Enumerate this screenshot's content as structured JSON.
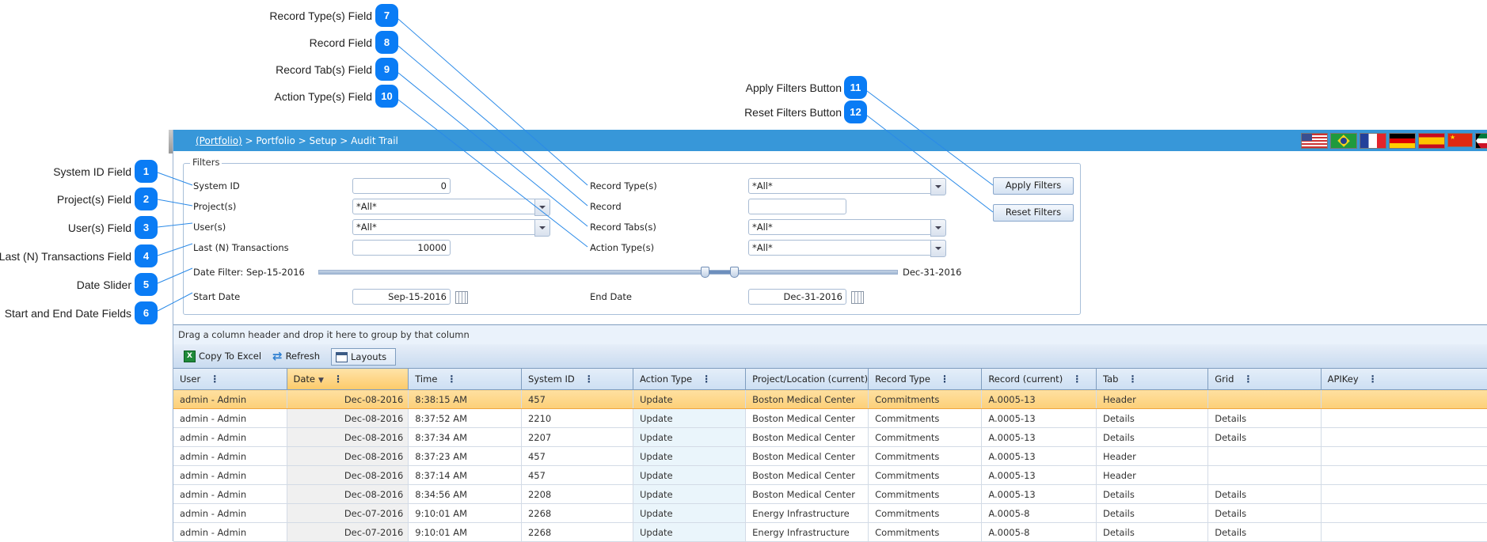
{
  "callouts": [
    {
      "n": "1",
      "label": "System ID Field"
    },
    {
      "n": "2",
      "label": "Project(s) Field"
    },
    {
      "n": "3",
      "label": "User(s) Field"
    },
    {
      "n": "4",
      "label": "Last (N) Transactions Field"
    },
    {
      "n": "5",
      "label": "Date Slider"
    },
    {
      "n": "6",
      "label": "Start and End Date Fields"
    },
    {
      "n": "7",
      "label": "Record Type(s) Field"
    },
    {
      "n": "8",
      "label": "Record Field"
    },
    {
      "n": "9",
      "label": "Record Tab(s) Field"
    },
    {
      "n": "10",
      "label": "Action Type(s) Field"
    },
    {
      "n": "11",
      "label": "Apply Filters Button"
    },
    {
      "n": "12",
      "label": "Reset Filters Button"
    }
  ],
  "breadcrumb": {
    "root": "(Portfolio)",
    "rest": " > Portfolio > Setup > Audit Trail"
  },
  "flags": [
    {
      "name": "us-flag"
    },
    {
      "name": "brazil-flag"
    },
    {
      "name": "france-flag"
    },
    {
      "name": "germany-flag"
    },
    {
      "name": "spain-flag"
    },
    {
      "name": "china-flag"
    },
    {
      "name": "kuwait-flag"
    }
  ],
  "filters": {
    "legend": "Filters",
    "system_id": {
      "label": "System ID",
      "value": "0"
    },
    "projects": {
      "label": "Project(s)",
      "value": "*All*"
    },
    "users": {
      "label": "User(s)",
      "value": "*All*"
    },
    "last_n": {
      "label": "Last (N) Transactions",
      "value": "10000"
    },
    "date_filter": {
      "label": "Date Filter: Sep-15-2016",
      "end_label": "Dec-31-2016"
    },
    "start_date": {
      "label": "Start Date",
      "value": "Sep-15-2016"
    },
    "end_date": {
      "label": "End Date",
      "value": "Dec-31-2016"
    },
    "record_types": {
      "label": "Record Type(s)",
      "value": "*All*"
    },
    "record": {
      "label": "Record",
      "value": ""
    },
    "record_tabs": {
      "label": "Record Tabs(s)",
      "value": "*All*"
    },
    "action_types": {
      "label": "Action Type(s)",
      "value": "*All*"
    },
    "apply_label": "Apply Filters",
    "reset_label": "Reset Filters"
  },
  "grid": {
    "group_hint": "Drag a column header and drop it here to group by that column",
    "toolbar": {
      "copy_excel": "Copy To Excel",
      "refresh": "Refresh",
      "layouts": "Layouts"
    },
    "columns": [
      "User",
      "Date",
      "Time",
      "System ID",
      "Action Type",
      "Project/Location (current)",
      "Record Type",
      "Record (current)",
      "Tab",
      "Grid",
      "APIKey"
    ],
    "rows": [
      [
        "admin - Admin",
        "Dec-08-2016",
        "8:38:15 AM",
        "457",
        "Update",
        "Boston Medical Center",
        "Commitments",
        "A.0005-13",
        "Header",
        "",
        ""
      ],
      [
        "admin - Admin",
        "Dec-08-2016",
        "8:37:52 AM",
        "2210",
        "Update",
        "Boston Medical Center",
        "Commitments",
        "A.0005-13",
        "Details",
        "Details",
        ""
      ],
      [
        "admin - Admin",
        "Dec-08-2016",
        "8:37:34 AM",
        "2207",
        "Update",
        "Boston Medical Center",
        "Commitments",
        "A.0005-13",
        "Details",
        "Details",
        ""
      ],
      [
        "admin - Admin",
        "Dec-08-2016",
        "8:37:23 AM",
        "457",
        "Update",
        "Boston Medical Center",
        "Commitments",
        "A.0005-13",
        "Header",
        "",
        ""
      ],
      [
        "admin - Admin",
        "Dec-08-2016",
        "8:37:14 AM",
        "457",
        "Update",
        "Boston Medical Center",
        "Commitments",
        "A.0005-13",
        "Header",
        "",
        ""
      ],
      [
        "admin - Admin",
        "Dec-08-2016",
        "8:34:56 AM",
        "2208",
        "Update",
        "Boston Medical Center",
        "Commitments",
        "A.0005-13",
        "Details",
        "Details",
        ""
      ],
      [
        "admin - Admin",
        "Dec-07-2016",
        "9:10:01 AM",
        "2268",
        "Update",
        "Energy Infrastructure",
        "Commitments",
        "A.0005-8",
        "Details",
        "Details",
        ""
      ],
      [
        "admin - Admin",
        "Dec-07-2016",
        "9:10:01 AM",
        "2268",
        "Update",
        "Energy Infrastructure",
        "Commitments",
        "A.0005-8",
        "Details",
        "Details",
        ""
      ]
    ],
    "selected_row": 0,
    "sorted_column": "Date"
  }
}
